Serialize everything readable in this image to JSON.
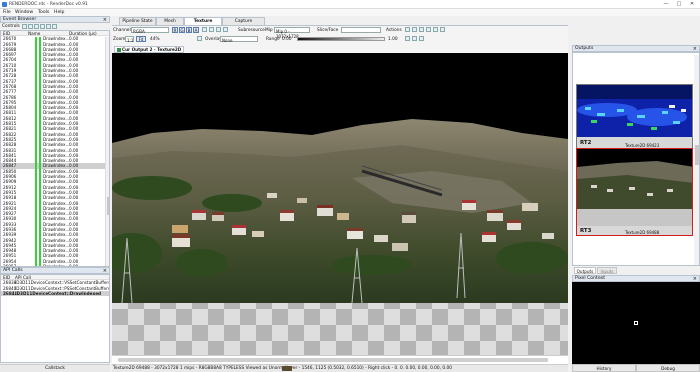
{
  "window": {
    "title": "RENDERDOC.rdc - RenderDoc v0.91",
    "controls": [
      "—",
      "□",
      "✕"
    ]
  },
  "menu": [
    "File",
    "Window",
    "Tools",
    "Help"
  ],
  "event_browser": {
    "title": "Event Browser",
    "controls_label": "Controls",
    "columns": [
      "EID",
      "Name",
      "Duration (µs)"
    ],
    "rows": [
      [
        "26670",
        "DrawIndex...",
        "0.00"
      ],
      [
        "26679",
        "DrawIndex...",
        "0.00"
      ],
      [
        "26688",
        "DrawIndex...",
        "0.00"
      ],
      [
        "26697",
        "DrawIndex...",
        "0.00"
      ],
      [
        "26704",
        "DrawIndex...",
        "0.00"
      ],
      [
        "26710",
        "DrawIndex...",
        "0.00"
      ],
      [
        "26719",
        "DrawIndex...",
        "0.00"
      ],
      [
        "26728",
        "DrawIndex...",
        "0.00"
      ],
      [
        "26737",
        "DrawIndex...",
        "0.00"
      ],
      [
        "26768",
        "DrawIndex...",
        "0.00"
      ],
      [
        "26777",
        "DrawIndex...",
        "0.00"
      ],
      [
        "26786",
        "DrawIndex...",
        "0.00"
      ],
      [
        "26795",
        "DrawIndex...",
        "0.00"
      ],
      [
        "26804",
        "DrawIndex...",
        "0.00"
      ],
      [
        "26811",
        "DrawIndex...",
        "0.00"
      ],
      [
        "26812",
        "DrawIndex...",
        "0.00"
      ],
      [
        "26815",
        "DrawIndex...",
        "0.00"
      ],
      [
        "26821",
        "DrawIndex...",
        "0.00"
      ],
      [
        "26822",
        "DrawIndex...",
        "0.00"
      ],
      [
        "26825",
        "DrawIndex...",
        "0.00"
      ],
      [
        "26828",
        "DrawIndex...",
        "0.00"
      ],
      [
        "26831",
        "DrawIndex...",
        "0.00"
      ],
      [
        "26841",
        "DrawIndex...",
        "0.00"
      ],
      [
        "26844",
        "DrawIndex...",
        "0.00"
      ],
      [
        "26847",
        "DrawIndex...",
        "0.00"
      ],
      [
        "26850",
        "DrawIndex...",
        "0.00"
      ],
      [
        "26906",
        "DrawIndex...",
        "0.00"
      ],
      [
        "26909",
        "DrawIndex...",
        "0.00"
      ],
      [
        "26912",
        "DrawIndex...",
        "0.00"
      ],
      [
        "26915",
        "DrawIndex...",
        "0.00"
      ],
      [
        "26918",
        "DrawIndex...",
        "0.00"
      ],
      [
        "26921",
        "DrawIndex...",
        "0.00"
      ],
      [
        "26924",
        "DrawIndex...",
        "0.00"
      ],
      [
        "26927",
        "DrawIndex...",
        "0.00"
      ],
      [
        "26930",
        "DrawIndex...",
        "0.00"
      ],
      [
        "26933",
        "DrawIndex...",
        "0.00"
      ],
      [
        "26936",
        "DrawIndex...",
        "0.00"
      ],
      [
        "26939",
        "DrawIndex...",
        "0.00"
      ],
      [
        "26942",
        "DrawIndex...",
        "0.00"
      ],
      [
        "26945",
        "DrawIndex...",
        "0.00"
      ],
      [
        "26948",
        "DrawIndex...",
        "0.00"
      ],
      [
        "26951",
        "DrawIndex...",
        "0.00"
      ],
      [
        "26954",
        "DrawIndex...",
        "0.00"
      ],
      [
        "26957",
        "DrawIndex...",
        "0.00"
      ],
      [
        "26960",
        "DrawIndex...",
        "0.00"
      ],
      [
        "26963",
        "DrawIndex...",
        "0.00"
      ],
      [
        "26966",
        "DrawIndex...",
        "0.00"
      ],
      [
        "26969",
        "DrawIndex...",
        "0.00"
      ],
      [
        "26972",
        "DrawIndex...",
        "0.00"
      ]
    ],
    "selected_index": 24
  },
  "api_calls": {
    "title": "API Calls",
    "columns": [
      "EID",
      "API Call"
    ],
    "rows": [
      [
        "26838",
        "ID3D11DeviceContext::VSSetConstantBuffers"
      ],
      [
        "26840",
        "ID3D11DeviceContext::PSSetConstantBuffers"
      ],
      [
        "2684...",
        "ID3D11DeviceContext::DrawIndexed"
      ]
    ],
    "callstack_label": "Callstack"
  },
  "tabs": [
    "Pipeline State",
    "Mesh Output",
    "Texture Viewer",
    "Capture Executable"
  ],
  "active_tab": 2,
  "texture_viewer": {
    "channels_label": "Channels",
    "channels_value": "RGBA",
    "channel_toggles": [
      "R",
      "G",
      "B",
      "A"
    ],
    "subresource_label": "Subresource",
    "subresource_value": "Mip 0 - 3072x1728",
    "mip_label": "Mip",
    "slice_label": "Slice/Face",
    "actions_label": "Actions",
    "zoom_label": "Zoom",
    "zoom_value": "1:1",
    "fit_label": "Fit",
    "zoom_percent": "44%",
    "overlay_label": "Overlay",
    "overlay_value": "None",
    "range_label": "Range",
    "range_min": "0.00",
    "range_max": "1.00",
    "output_tab": "Cur Output 2 - Texture2D 6..."
  },
  "status": "Texture2D 69488 - 3072x1728 1 mips - R8G8B8A8 TYPELESS Viewed as Unorm  Hover - 1546, 1125 (0.5032, 0.6510) - Right click -  0.  0. 0.00, 0.00, 0.00, 0.00",
  "outputs": {
    "title": "Outputs",
    "targets": [
      {
        "name": "RT2",
        "format": "Texture2D 69423"
      },
      {
        "name": "RT3",
        "format": "Texture2D 69488"
      }
    ],
    "bottom_tabs": [
      "Outputs",
      "Inputs"
    ]
  },
  "pixel_context": {
    "title": "Pixel Context",
    "history_button": "History",
    "debug_button": "Debug"
  }
}
